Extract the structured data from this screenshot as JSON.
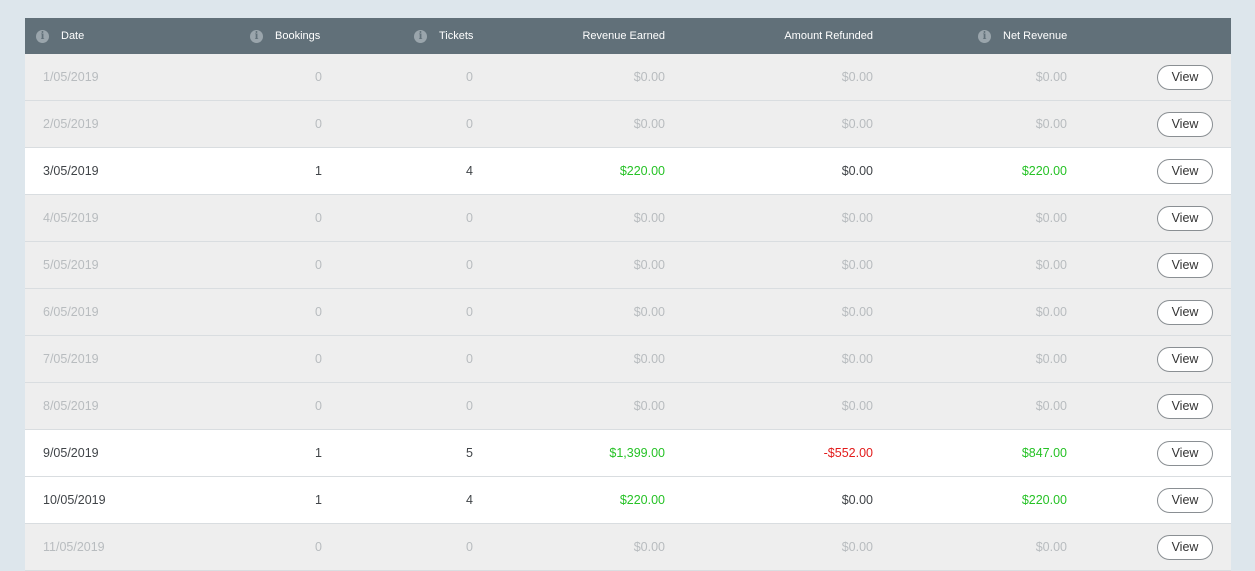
{
  "columns": {
    "date": "Date",
    "bookings": "Bookings",
    "tickets": "Tickets",
    "revenue": "Revenue Earned",
    "refunded": "Amount Refunded",
    "net": "Net Revenue"
  },
  "info_glyph": "i",
  "view_label": "View",
  "colors": {
    "header_bg": "#617079",
    "positive": "#26c226",
    "negative": "#e21b1b",
    "muted": "#b8bcbf"
  },
  "rows": [
    {
      "date": "1/05/2019",
      "bookings": "0",
      "tickets": "0",
      "revenue": "$0.00",
      "refunded": "$0.00",
      "net": "$0.00"
    },
    {
      "date": "2/05/2019",
      "bookings": "0",
      "tickets": "0",
      "revenue": "$0.00",
      "refunded": "$0.00",
      "net": "$0.00"
    },
    {
      "date": "3/05/2019",
      "bookings": "1",
      "tickets": "4",
      "revenue": "$220.00",
      "refunded": "$0.00",
      "net": "$220.00"
    },
    {
      "date": "4/05/2019",
      "bookings": "0",
      "tickets": "0",
      "revenue": "$0.00",
      "refunded": "$0.00",
      "net": "$0.00"
    },
    {
      "date": "5/05/2019",
      "bookings": "0",
      "tickets": "0",
      "revenue": "$0.00",
      "refunded": "$0.00",
      "net": "$0.00"
    },
    {
      "date": "6/05/2019",
      "bookings": "0",
      "tickets": "0",
      "revenue": "$0.00",
      "refunded": "$0.00",
      "net": "$0.00"
    },
    {
      "date": "7/05/2019",
      "bookings": "0",
      "tickets": "0",
      "revenue": "$0.00",
      "refunded": "$0.00",
      "net": "$0.00"
    },
    {
      "date": "8/05/2019",
      "bookings": "0",
      "tickets": "0",
      "revenue": "$0.00",
      "refunded": "$0.00",
      "net": "$0.00"
    },
    {
      "date": "9/05/2019",
      "bookings": "1",
      "tickets": "5",
      "revenue": "$1,399.00",
      "refunded": "-$552.00",
      "net": "$847.00"
    },
    {
      "date": "10/05/2019",
      "bookings": "1",
      "tickets": "4",
      "revenue": "$220.00",
      "refunded": "$0.00",
      "net": "$220.00"
    },
    {
      "date": "11/05/2019",
      "bookings": "0",
      "tickets": "0",
      "revenue": "$0.00",
      "refunded": "$0.00",
      "net": "$0.00"
    }
  ]
}
